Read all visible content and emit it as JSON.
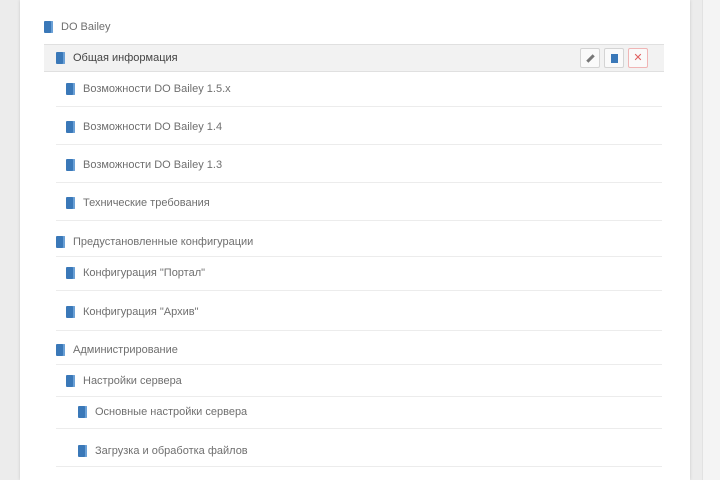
{
  "tree": {
    "root": "DO Bailey",
    "items": [
      {
        "label": "Общая информация"
      },
      {
        "label": "Возможности DO Bailey 1.5.x"
      },
      {
        "label": "Возможности DO Bailey 1.4"
      },
      {
        "label": "Возможности DO Bailey 1.3"
      },
      {
        "label": "Технические требования"
      },
      {
        "label": "Предустановленные конфигурации"
      },
      {
        "label": "Конфигурация \"Портал\""
      },
      {
        "label": "Конфигурация \"Архив\""
      },
      {
        "label": "Администрирование"
      },
      {
        "label": "Настройки сервера"
      },
      {
        "label": "Основные настройки сервера"
      },
      {
        "label": "Загрузка и обработка файлов"
      }
    ]
  },
  "toolbar": {
    "edit_icon": "edit-icon",
    "page_icon": "page-icon",
    "delete_icon": "delete-icon"
  },
  "colors": {
    "doc_icon": "#3a78b8",
    "delete": "#e06060"
  }
}
